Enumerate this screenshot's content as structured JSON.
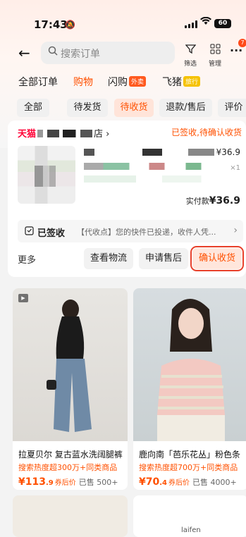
{
  "status_bar": {
    "time": "17:43",
    "battery": "60"
  },
  "header": {
    "search_placeholder": "搜索订单",
    "filter_label": "筛选",
    "manage_label": "管理",
    "notification_count": "7"
  },
  "tabs": [
    {
      "label": "全部订单"
    },
    {
      "label": "购物"
    },
    {
      "label": "闪购",
      "tag": "外卖",
      "tag_color": "#ff5a1f"
    },
    {
      "label": "飞猪",
      "tag": "旅行",
      "tag_color": "#f5c200"
    }
  ],
  "chips": [
    "全部",
    "待发货",
    "待收货",
    "退款/售后",
    "评价"
  ],
  "order": {
    "shop_brand": "天猫",
    "shop_suffix": "店",
    "status": "已签收,待确认收货",
    "price": "¥36.9",
    "quantity": "×1",
    "paid_label": "实付款",
    "paid_amount": "¥36.9",
    "logistics_status": "已签收",
    "logistics_message": "【代收点】您的快件已投递，收件人凭...",
    "more_label": "更多",
    "buttons": [
      "查看物流",
      "申请售后",
      "确认收货"
    ]
  },
  "products": [
    {
      "title": "拉夏贝尔 复古蓝水洗阔腿裤",
      "heat": "搜索热度超300万+同类商品",
      "price_int": "¥113",
      "price_dec": ".9",
      "after_coupon": "券后价",
      "sold": "已售 500+"
    },
    {
      "title": "鹿向南「芭乐花丛」粉色条",
      "heat": "搜索热度超700万+同类商品",
      "price_int": "¥70",
      "price_dec": ".4",
      "after_coupon": "券后价",
      "sold": "已售 4000+"
    }
  ],
  "bottom_brand": "laifen"
}
